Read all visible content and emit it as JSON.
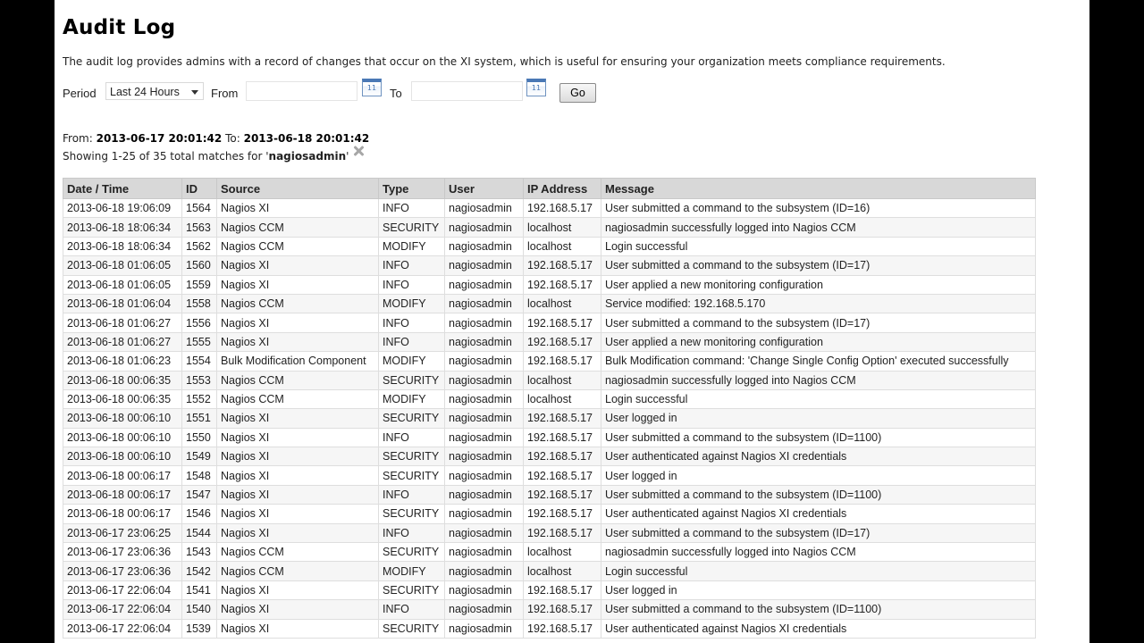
{
  "page": {
    "title": "Audit Log",
    "description": "The audit log provides admins with a record of changes that occur on the XI system, which is useful for ensuring your organization meets compliance requirements."
  },
  "filter": {
    "period_label": "Period",
    "period_value": "Last 24 Hours",
    "from_label": "From",
    "from_value": "",
    "to_label": "To",
    "to_value": "",
    "calendar_day": "11",
    "go_label": "Go"
  },
  "summary": {
    "from_prefix": "From:",
    "from_date": "2013-06-17 20:01:42",
    "to_prefix": "To:",
    "to_date": "2013-06-18 20:01:42",
    "showing_prefix": "Showing 1-25 of 35 total matches for '",
    "search_term": "nagiosadmin",
    "showing_suffix": "'"
  },
  "table": {
    "headers": [
      "Date / Time",
      "ID",
      "Source",
      "Type",
      "User",
      "IP Address",
      "Message"
    ],
    "rows": [
      [
        "2013-06-18 19:06:09",
        "1564",
        "Nagios XI",
        "INFO",
        "nagiosadmin",
        "192.168.5.17",
        "User submitted a command to the subsystem (ID=16)"
      ],
      [
        "2013-06-18 18:06:34",
        "1563",
        "Nagios CCM",
        "SECURITY",
        "nagiosadmin",
        "localhost",
        "nagiosadmin successfully logged into Nagios CCM"
      ],
      [
        "2013-06-18 18:06:34",
        "1562",
        "Nagios CCM",
        "MODIFY",
        "nagiosadmin",
        "localhost",
        "Login successful"
      ],
      [
        "2013-06-18 01:06:05",
        "1560",
        "Nagios XI",
        "INFO",
        "nagiosadmin",
        "192.168.5.17",
        "User submitted a command to the subsystem (ID=17)"
      ],
      [
        "2013-06-18 01:06:05",
        "1559",
        "Nagios XI",
        "INFO",
        "nagiosadmin",
        "192.168.5.17",
        "User applied a new monitoring configuration"
      ],
      [
        "2013-06-18 01:06:04",
        "1558",
        "Nagios CCM",
        "MODIFY",
        "nagiosadmin",
        "localhost",
        "Service modified: 192.168.5.170"
      ],
      [
        "2013-06-18 01:06:27",
        "1556",
        "Nagios XI",
        "INFO",
        "nagiosadmin",
        "192.168.5.17",
        "User submitted a command to the subsystem (ID=17)"
      ],
      [
        "2013-06-18 01:06:27",
        "1555",
        "Nagios XI",
        "INFO",
        "nagiosadmin",
        "192.168.5.17",
        "User applied a new monitoring configuration"
      ],
      [
        "2013-06-18 01:06:23",
        "1554",
        "Bulk Modification Component",
        "MODIFY",
        "nagiosadmin",
        "192.168.5.17",
        "Bulk Modification command: 'Change Single Config Option' executed successfully"
      ],
      [
        "2013-06-18 00:06:35",
        "1553",
        "Nagios CCM",
        "SECURITY",
        "nagiosadmin",
        "localhost",
        "nagiosadmin successfully logged into Nagios CCM"
      ],
      [
        "2013-06-18 00:06:35",
        "1552",
        "Nagios CCM",
        "MODIFY",
        "nagiosadmin",
        "localhost",
        "Login successful"
      ],
      [
        "2013-06-18 00:06:10",
        "1551",
        "Nagios XI",
        "SECURITY",
        "nagiosadmin",
        "192.168.5.17",
        "User logged in"
      ],
      [
        "2013-06-18 00:06:10",
        "1550",
        "Nagios XI",
        "INFO",
        "nagiosadmin",
        "192.168.5.17",
        "User submitted a command to the subsystem (ID=1100)"
      ],
      [
        "2013-06-18 00:06:10",
        "1549",
        "Nagios XI",
        "SECURITY",
        "nagiosadmin",
        "192.168.5.17",
        "User authenticated against Nagios XI credentials"
      ],
      [
        "2013-06-18 00:06:17",
        "1548",
        "Nagios XI",
        "SECURITY",
        "nagiosadmin",
        "192.168.5.17",
        "User logged in"
      ],
      [
        "2013-06-18 00:06:17",
        "1547",
        "Nagios XI",
        "INFO",
        "nagiosadmin",
        "192.168.5.17",
        "User submitted a command to the subsystem (ID=1100)"
      ],
      [
        "2013-06-18 00:06:17",
        "1546",
        "Nagios XI",
        "SECURITY",
        "nagiosadmin",
        "192.168.5.17",
        "User authenticated against Nagios XI credentials"
      ],
      [
        "2013-06-17 23:06:25",
        "1544",
        "Nagios XI",
        "INFO",
        "nagiosadmin",
        "192.168.5.17",
        "User submitted a command to the subsystem (ID=17)"
      ],
      [
        "2013-06-17 23:06:36",
        "1543",
        "Nagios CCM",
        "SECURITY",
        "nagiosadmin",
        "localhost",
        "nagiosadmin successfully logged into Nagios CCM"
      ],
      [
        "2013-06-17 23:06:36",
        "1542",
        "Nagios CCM",
        "MODIFY",
        "nagiosadmin",
        "localhost",
        "Login successful"
      ],
      [
        "2013-06-17 22:06:04",
        "1541",
        "Nagios XI",
        "SECURITY",
        "nagiosadmin",
        "192.168.5.17",
        "User logged in"
      ],
      [
        "2013-06-17 22:06:04",
        "1540",
        "Nagios XI",
        "INFO",
        "nagiosadmin",
        "192.168.5.17",
        "User submitted a command to the subsystem (ID=1100)"
      ],
      [
        "2013-06-17 22:06:04",
        "1539",
        "Nagios XI",
        "SECURITY",
        "nagiosadmin",
        "192.168.5.17",
        "User authenticated against Nagios XI credentials"
      ]
    ]
  }
}
